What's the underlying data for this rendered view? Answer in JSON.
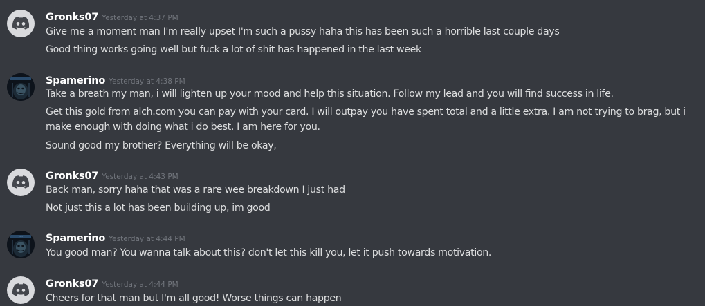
{
  "messages": [
    {
      "username": "Gronks07",
      "avatar": "discord-logo-icon",
      "timestamp": "Yesterday at 4:37 PM",
      "lines": [
        "Give me a moment man I'm really upset I'm such a pussy haha this has been such a horrible last couple days",
        "Good thing works going well but fuck a lot of shit has happened in the last week"
      ]
    },
    {
      "username": "Spamerino",
      "avatar": "dark-avatar-image",
      "timestamp": "Yesterday at 4:38 PM",
      "lines": [
        "Take a breath my man, i will lighten up your mood and help this situation. Follow my lead and you will find success in life.",
        "Get this gold from alch.com you can pay with your card. I will outpay you have spent total and a little extra. I am not trying to brag, but i make enough with doing what i do best. I am here for you.",
        "Sound good my brother? Everything will be okay,"
      ]
    },
    {
      "username": "Gronks07",
      "avatar": "discord-logo-icon",
      "timestamp": "Yesterday at 4:43 PM",
      "lines": [
        "Back man, sorry haha that was a rare wee breakdown I just had",
        "Not just this a lot has been building up, im good"
      ]
    },
    {
      "username": "Spamerino",
      "avatar": "dark-avatar-image",
      "timestamp": "Yesterday at 4:44 PM",
      "lines": [
        "You good man? You wanna talk about this? don't let this kill you, let it push towards motivation."
      ]
    },
    {
      "username": "Gronks07",
      "avatar": "discord-logo-icon",
      "timestamp": "Yesterday at 4:44 PM",
      "lines": [
        "Cheers for that man but I'm all good! Worse things can happen"
      ]
    }
  ]
}
